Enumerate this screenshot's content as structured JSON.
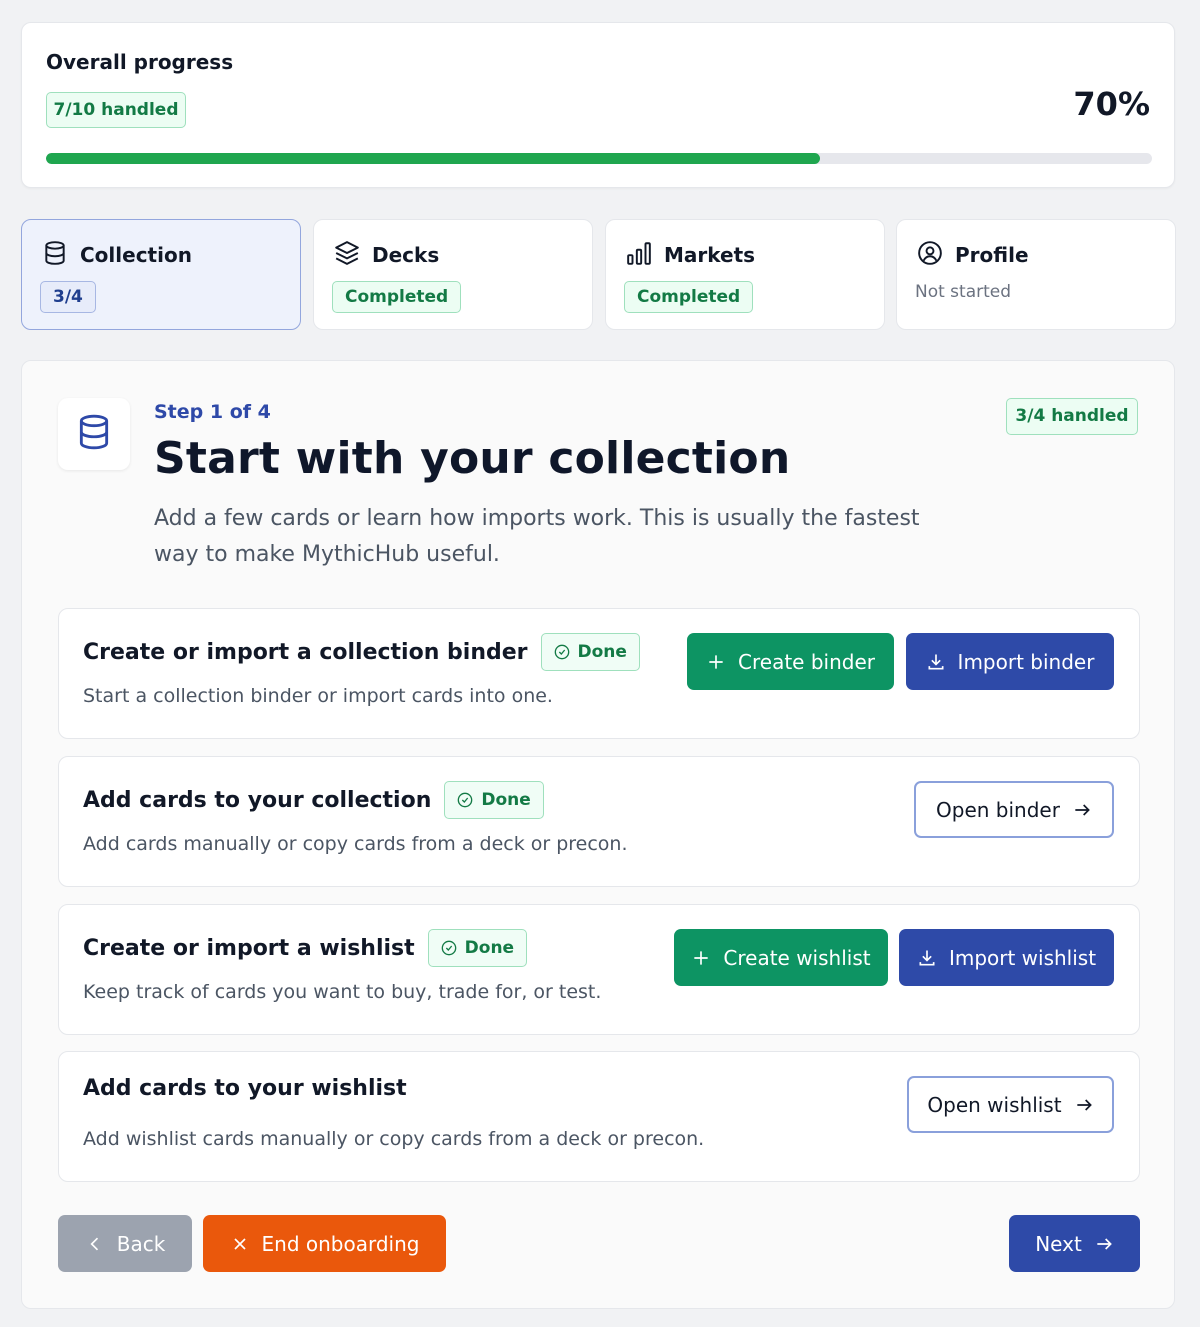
{
  "progress": {
    "title": "Overall progress",
    "handled_badge": "7/10 handled",
    "percent_label": "70%",
    "percent_value": 70
  },
  "tabs": [
    {
      "label": "Collection",
      "status": "3/4",
      "icon": "database-icon",
      "active": true
    },
    {
      "label": "Decks",
      "status": "Completed",
      "icon": "layers-icon"
    },
    {
      "label": "Markets",
      "status": "Completed",
      "icon": "bar-chart-icon"
    },
    {
      "label": "Profile",
      "status": "Not started",
      "icon": "user-circle-icon"
    }
  ],
  "step": {
    "label": "Step 1 of 4",
    "title": "Start with your collection",
    "description": "Add a few cards or learn how imports work. This is usually the fastest way to make MythicHub useful.",
    "handled_badge": "3/4 handled",
    "icon": "database-icon"
  },
  "tasks": [
    {
      "title": "Create or import a collection binder",
      "badge": "Done",
      "description": "Start a collection binder or import cards into one.",
      "primary": "Create binder",
      "secondary": "Import binder"
    },
    {
      "title": "Add cards to your collection",
      "badge": "Done",
      "description": "Add cards manually or copy cards from a deck or precon.",
      "action": "Open binder"
    },
    {
      "title": "Create or import a wishlist",
      "badge": "Done",
      "description": "Keep track of cards you want to buy, trade for, or test.",
      "primary": "Create wishlist",
      "secondary": "Import wishlist"
    },
    {
      "title": "Add cards to your wishlist",
      "description": "Add wishlist cards manually or copy cards from a deck or precon.",
      "action": "Open wishlist"
    }
  ],
  "footer": {
    "back": "Back",
    "end": "End onboarding",
    "next": "Next"
  },
  "colors": {
    "green": "#0d9463",
    "blue": "#2e4aa8",
    "orange": "#ea580c",
    "gray": "#9ca3af",
    "progress_fill": "#1fa64f"
  }
}
